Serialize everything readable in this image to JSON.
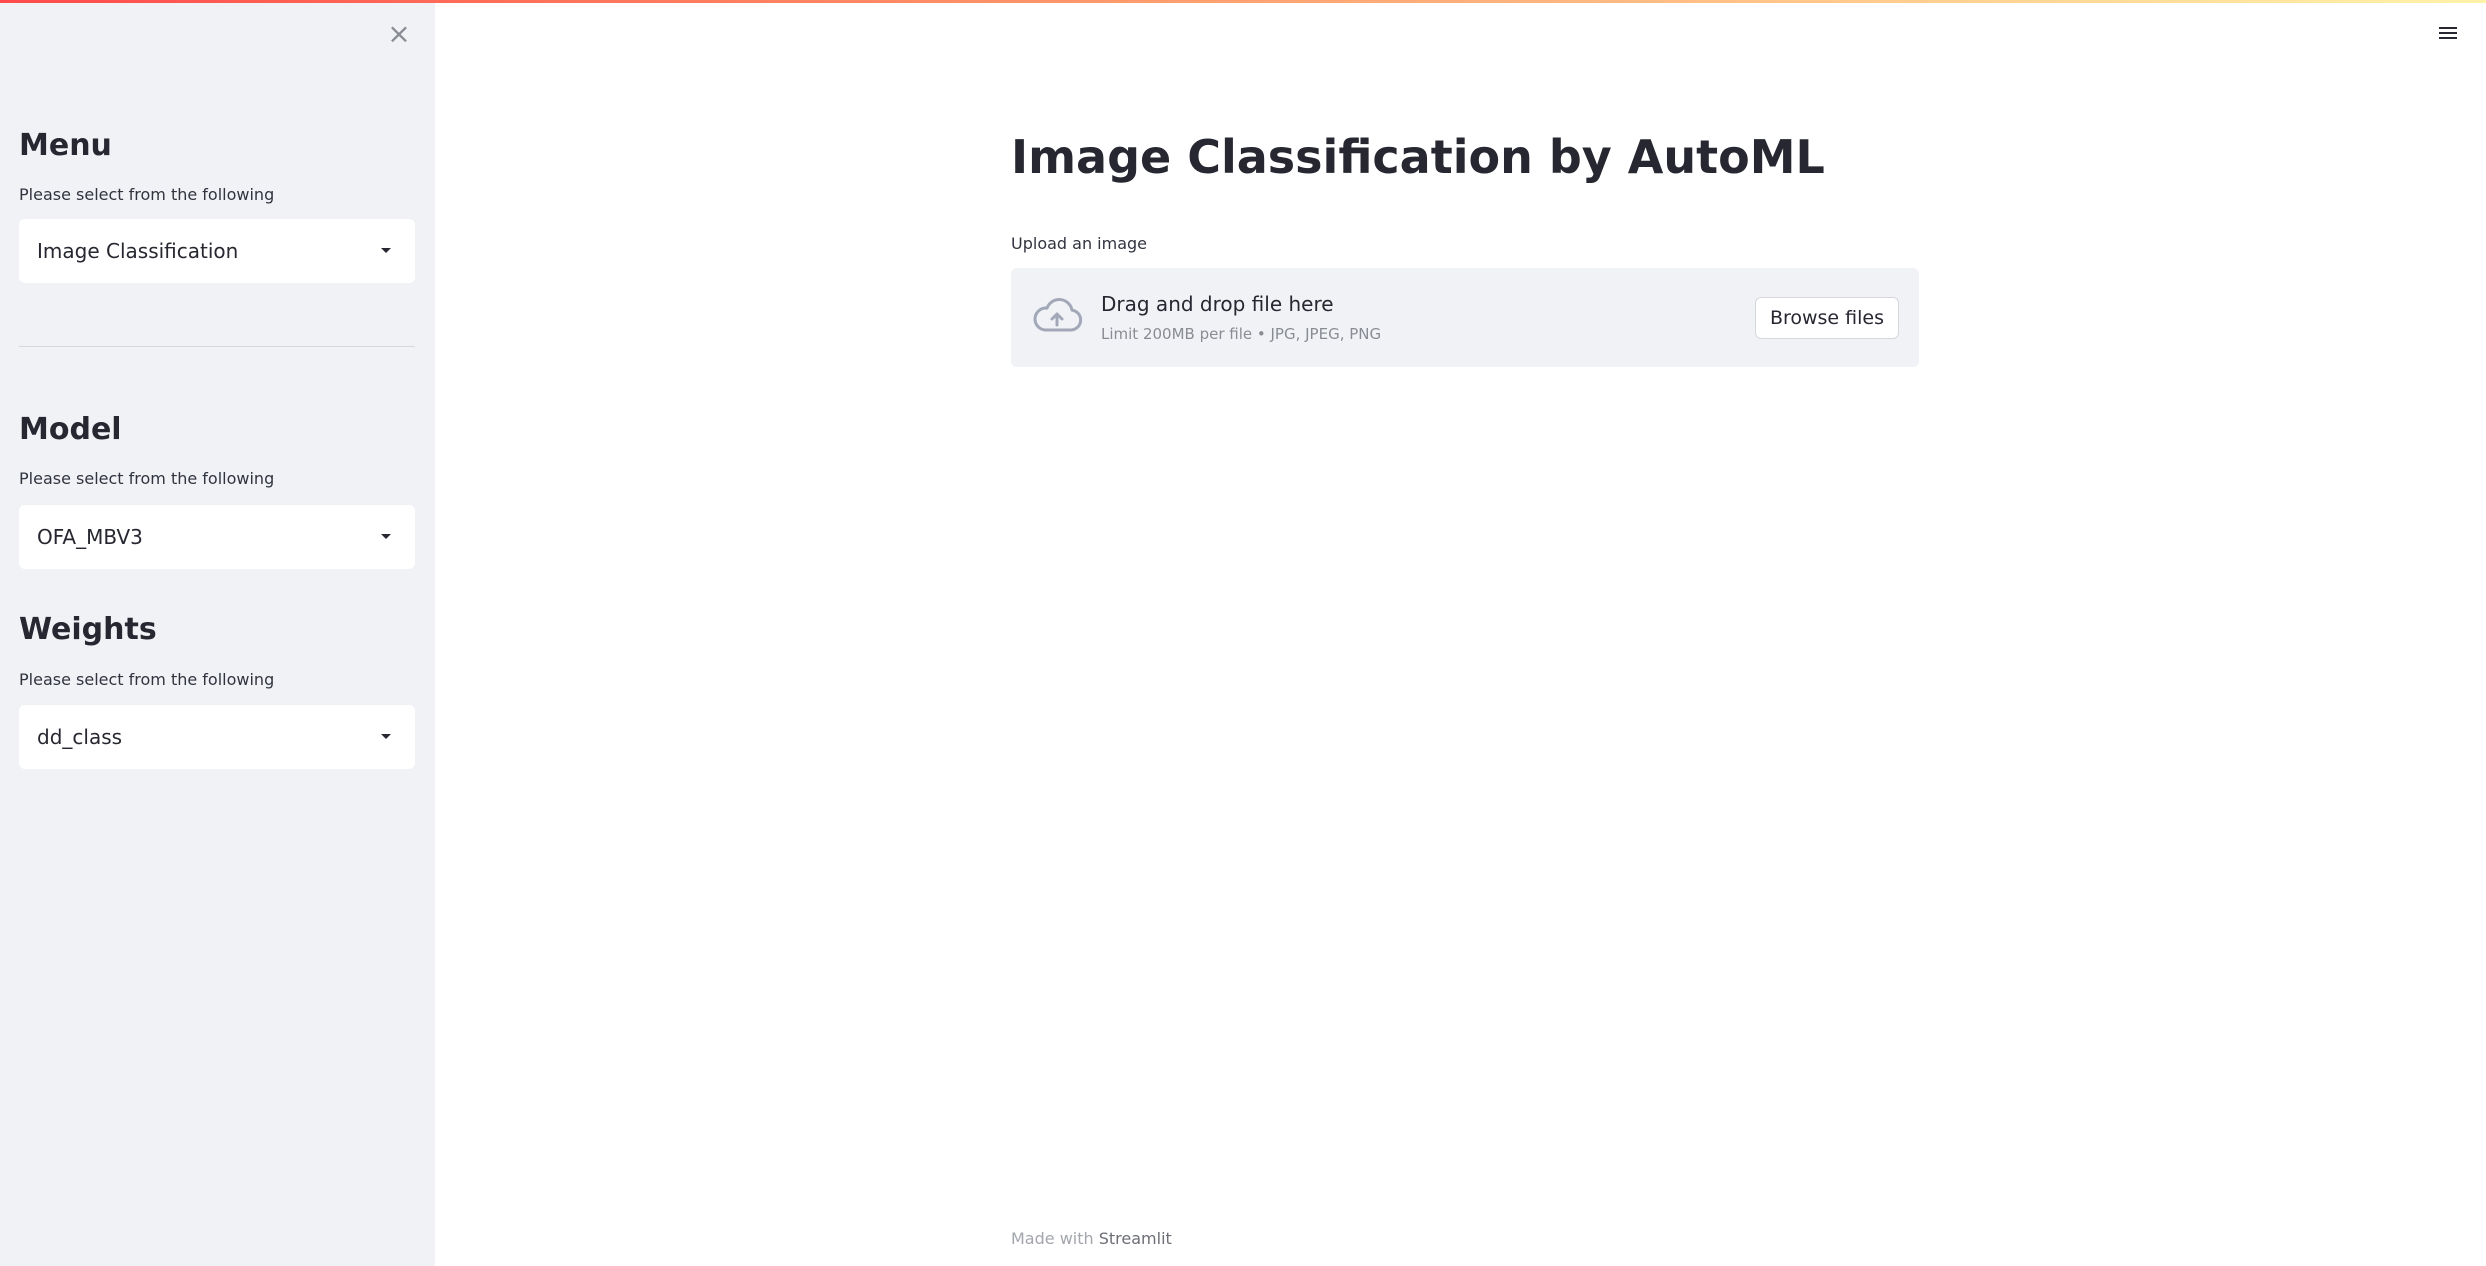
{
  "sidebar": {
    "close_icon": "close-icon",
    "menu": {
      "title": "Menu",
      "caption": "Please select from the following",
      "selected": "Image Classification"
    },
    "model": {
      "title": "Model",
      "caption": "Please select from the following",
      "selected": "OFA_MBV3"
    },
    "weights": {
      "title": "Weights",
      "caption": "Please select from the following",
      "selected": "dd_class"
    }
  },
  "header": {
    "menu_icon": "hamburger-icon"
  },
  "main": {
    "title": "Image Classification by AutoML",
    "uploader": {
      "label": "Upload an image",
      "drop_text": "Drag and drop file here",
      "limit_text": "Limit 200MB per file • JPG, JPEG, PNG",
      "browse_label": "Browse files",
      "icon": "cloud-upload-icon"
    }
  },
  "footer": {
    "made_with": "Made with",
    "brand": "Streamlit"
  },
  "colors": {
    "sidebar_bg": "#f0f2f6",
    "text": "#262730",
    "accent_gradient_start": "#ff4b4b",
    "accent_gradient_end": "#fff3a8"
  }
}
